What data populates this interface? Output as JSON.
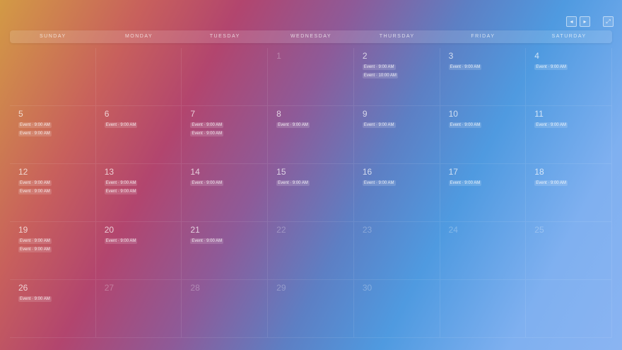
{
  "nav": {
    "prev_icon": "◂",
    "next_icon": "▸",
    "expand_icon": "⤢"
  },
  "weekdays": [
    "Sunday",
    "Monday",
    "Tuesday",
    "Wednesday",
    "Thursday",
    "Friday",
    "Saturday"
  ],
  "days": [
    {
      "num": "",
      "events": []
    },
    {
      "num": "",
      "events": []
    },
    {
      "num": "",
      "events": []
    },
    {
      "num": "1",
      "faded": true,
      "events": []
    },
    {
      "num": "2",
      "events": [
        "Event · 9:00 AM",
        "Event · 10:00 AM"
      ]
    },
    {
      "num": "3",
      "events": [
        "Event · 9:00 AM"
      ]
    },
    {
      "num": "4",
      "events": [
        "Event · 9:00 AM"
      ]
    },
    {
      "num": "5",
      "events": [
        "Event · 9:00 AM",
        "Event · 9:00 AM"
      ]
    },
    {
      "num": "6",
      "events": [
        "Event · 9:00 AM"
      ]
    },
    {
      "num": "7",
      "events": [
        "Event · 9:00 AM",
        "Event · 9:00 AM"
      ]
    },
    {
      "num": "8",
      "events": [
        "Event · 9:00 AM"
      ]
    },
    {
      "num": "9",
      "events": [
        "Event · 9:00 AM"
      ]
    },
    {
      "num": "10",
      "events": [
        "Event · 9:00 AM"
      ]
    },
    {
      "num": "11",
      "events": [
        "Event · 9:00 AM"
      ]
    },
    {
      "num": "12",
      "events": [
        "Event · 9:00 AM",
        "Event · 9:00 AM"
      ]
    },
    {
      "num": "13",
      "events": [
        "Event · 9:00 AM",
        "Event · 9:00 AM"
      ]
    },
    {
      "num": "14",
      "events": [
        "Event · 9:00 AM"
      ]
    },
    {
      "num": "15",
      "events": [
        "Event · 9:00 AM"
      ]
    },
    {
      "num": "16",
      "events": [
        "Event · 9:00 AM"
      ]
    },
    {
      "num": "17",
      "events": [
        "Event · 9:00 AM"
      ]
    },
    {
      "num": "18",
      "events": [
        "Event · 9:00 AM"
      ]
    },
    {
      "num": "19",
      "events": [
        "Event · 9:00 AM",
        "Event · 9:00 AM"
      ]
    },
    {
      "num": "20",
      "events": [
        "Event · 9:00 AM"
      ]
    },
    {
      "num": "21",
      "events": [
        "Event · 9:00 AM"
      ]
    },
    {
      "num": "22",
      "faded": true,
      "events": []
    },
    {
      "num": "23",
      "faded": true,
      "events": []
    },
    {
      "num": "24",
      "faded": true,
      "events": []
    },
    {
      "num": "25",
      "faded": true,
      "events": []
    },
    {
      "num": "26",
      "events": [
        "Event · 9:00 AM"
      ]
    },
    {
      "num": "27",
      "faded": true,
      "events": []
    },
    {
      "num": "28",
      "faded": true,
      "events": []
    },
    {
      "num": "29",
      "faded": true,
      "events": []
    },
    {
      "num": "30",
      "faded": true,
      "events": []
    },
    {
      "num": "",
      "events": []
    },
    {
      "num": "",
      "events": []
    }
  ]
}
